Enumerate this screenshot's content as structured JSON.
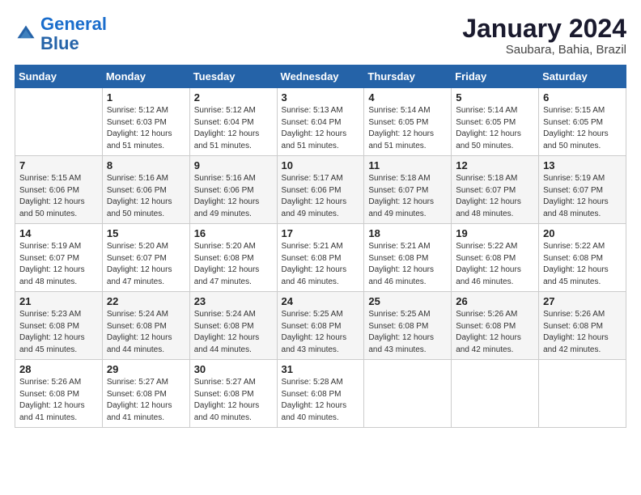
{
  "header": {
    "logo_general": "General",
    "logo_blue": "Blue",
    "month": "January 2024",
    "location": "Saubara, Bahia, Brazil"
  },
  "days_of_week": [
    "Sunday",
    "Monday",
    "Tuesday",
    "Wednesday",
    "Thursday",
    "Friday",
    "Saturday"
  ],
  "weeks": [
    [
      {
        "day": "",
        "sunrise": "",
        "sunset": "",
        "daylight": ""
      },
      {
        "day": "1",
        "sunrise": "Sunrise: 5:12 AM",
        "sunset": "Sunset: 6:03 PM",
        "daylight": "Daylight: 12 hours and 51 minutes."
      },
      {
        "day": "2",
        "sunrise": "Sunrise: 5:12 AM",
        "sunset": "Sunset: 6:04 PM",
        "daylight": "Daylight: 12 hours and 51 minutes."
      },
      {
        "day": "3",
        "sunrise": "Sunrise: 5:13 AM",
        "sunset": "Sunset: 6:04 PM",
        "daylight": "Daylight: 12 hours and 51 minutes."
      },
      {
        "day": "4",
        "sunrise": "Sunrise: 5:14 AM",
        "sunset": "Sunset: 6:05 PM",
        "daylight": "Daylight: 12 hours and 51 minutes."
      },
      {
        "day": "5",
        "sunrise": "Sunrise: 5:14 AM",
        "sunset": "Sunset: 6:05 PM",
        "daylight": "Daylight: 12 hours and 50 minutes."
      },
      {
        "day": "6",
        "sunrise": "Sunrise: 5:15 AM",
        "sunset": "Sunset: 6:05 PM",
        "daylight": "Daylight: 12 hours and 50 minutes."
      }
    ],
    [
      {
        "day": "7",
        "sunrise": "Sunrise: 5:15 AM",
        "sunset": "Sunset: 6:06 PM",
        "daylight": "Daylight: 12 hours and 50 minutes."
      },
      {
        "day": "8",
        "sunrise": "Sunrise: 5:16 AM",
        "sunset": "Sunset: 6:06 PM",
        "daylight": "Daylight: 12 hours and 50 minutes."
      },
      {
        "day": "9",
        "sunrise": "Sunrise: 5:16 AM",
        "sunset": "Sunset: 6:06 PM",
        "daylight": "Daylight: 12 hours and 49 minutes."
      },
      {
        "day": "10",
        "sunrise": "Sunrise: 5:17 AM",
        "sunset": "Sunset: 6:06 PM",
        "daylight": "Daylight: 12 hours and 49 minutes."
      },
      {
        "day": "11",
        "sunrise": "Sunrise: 5:18 AM",
        "sunset": "Sunset: 6:07 PM",
        "daylight": "Daylight: 12 hours and 49 minutes."
      },
      {
        "day": "12",
        "sunrise": "Sunrise: 5:18 AM",
        "sunset": "Sunset: 6:07 PM",
        "daylight": "Daylight: 12 hours and 48 minutes."
      },
      {
        "day": "13",
        "sunrise": "Sunrise: 5:19 AM",
        "sunset": "Sunset: 6:07 PM",
        "daylight": "Daylight: 12 hours and 48 minutes."
      }
    ],
    [
      {
        "day": "14",
        "sunrise": "Sunrise: 5:19 AM",
        "sunset": "Sunset: 6:07 PM",
        "daylight": "Daylight: 12 hours and 48 minutes."
      },
      {
        "day": "15",
        "sunrise": "Sunrise: 5:20 AM",
        "sunset": "Sunset: 6:07 PM",
        "daylight": "Daylight: 12 hours and 47 minutes."
      },
      {
        "day": "16",
        "sunrise": "Sunrise: 5:20 AM",
        "sunset": "Sunset: 6:08 PM",
        "daylight": "Daylight: 12 hours and 47 minutes."
      },
      {
        "day": "17",
        "sunrise": "Sunrise: 5:21 AM",
        "sunset": "Sunset: 6:08 PM",
        "daylight": "Daylight: 12 hours and 46 minutes."
      },
      {
        "day": "18",
        "sunrise": "Sunrise: 5:21 AM",
        "sunset": "Sunset: 6:08 PM",
        "daylight": "Daylight: 12 hours and 46 minutes."
      },
      {
        "day": "19",
        "sunrise": "Sunrise: 5:22 AM",
        "sunset": "Sunset: 6:08 PM",
        "daylight": "Daylight: 12 hours and 46 minutes."
      },
      {
        "day": "20",
        "sunrise": "Sunrise: 5:22 AM",
        "sunset": "Sunset: 6:08 PM",
        "daylight": "Daylight: 12 hours and 45 minutes."
      }
    ],
    [
      {
        "day": "21",
        "sunrise": "Sunrise: 5:23 AM",
        "sunset": "Sunset: 6:08 PM",
        "daylight": "Daylight: 12 hours and 45 minutes."
      },
      {
        "day": "22",
        "sunrise": "Sunrise: 5:24 AM",
        "sunset": "Sunset: 6:08 PM",
        "daylight": "Daylight: 12 hours and 44 minutes."
      },
      {
        "day": "23",
        "sunrise": "Sunrise: 5:24 AM",
        "sunset": "Sunset: 6:08 PM",
        "daylight": "Daylight: 12 hours and 44 minutes."
      },
      {
        "day": "24",
        "sunrise": "Sunrise: 5:25 AM",
        "sunset": "Sunset: 6:08 PM",
        "daylight": "Daylight: 12 hours and 43 minutes."
      },
      {
        "day": "25",
        "sunrise": "Sunrise: 5:25 AM",
        "sunset": "Sunset: 6:08 PM",
        "daylight": "Daylight: 12 hours and 43 minutes."
      },
      {
        "day": "26",
        "sunrise": "Sunrise: 5:26 AM",
        "sunset": "Sunset: 6:08 PM",
        "daylight": "Daylight: 12 hours and 42 minutes."
      },
      {
        "day": "27",
        "sunrise": "Sunrise: 5:26 AM",
        "sunset": "Sunset: 6:08 PM",
        "daylight": "Daylight: 12 hours and 42 minutes."
      }
    ],
    [
      {
        "day": "28",
        "sunrise": "Sunrise: 5:26 AM",
        "sunset": "Sunset: 6:08 PM",
        "daylight": "Daylight: 12 hours and 41 minutes."
      },
      {
        "day": "29",
        "sunrise": "Sunrise: 5:27 AM",
        "sunset": "Sunset: 6:08 PM",
        "daylight": "Daylight: 12 hours and 41 minutes."
      },
      {
        "day": "30",
        "sunrise": "Sunrise: 5:27 AM",
        "sunset": "Sunset: 6:08 PM",
        "daylight": "Daylight: 12 hours and 40 minutes."
      },
      {
        "day": "31",
        "sunrise": "Sunrise: 5:28 AM",
        "sunset": "Sunset: 6:08 PM",
        "daylight": "Daylight: 12 hours and 40 minutes."
      },
      {
        "day": "",
        "sunrise": "",
        "sunset": "",
        "daylight": ""
      },
      {
        "day": "",
        "sunrise": "",
        "sunset": "",
        "daylight": ""
      },
      {
        "day": "",
        "sunrise": "",
        "sunset": "",
        "daylight": ""
      }
    ]
  ]
}
